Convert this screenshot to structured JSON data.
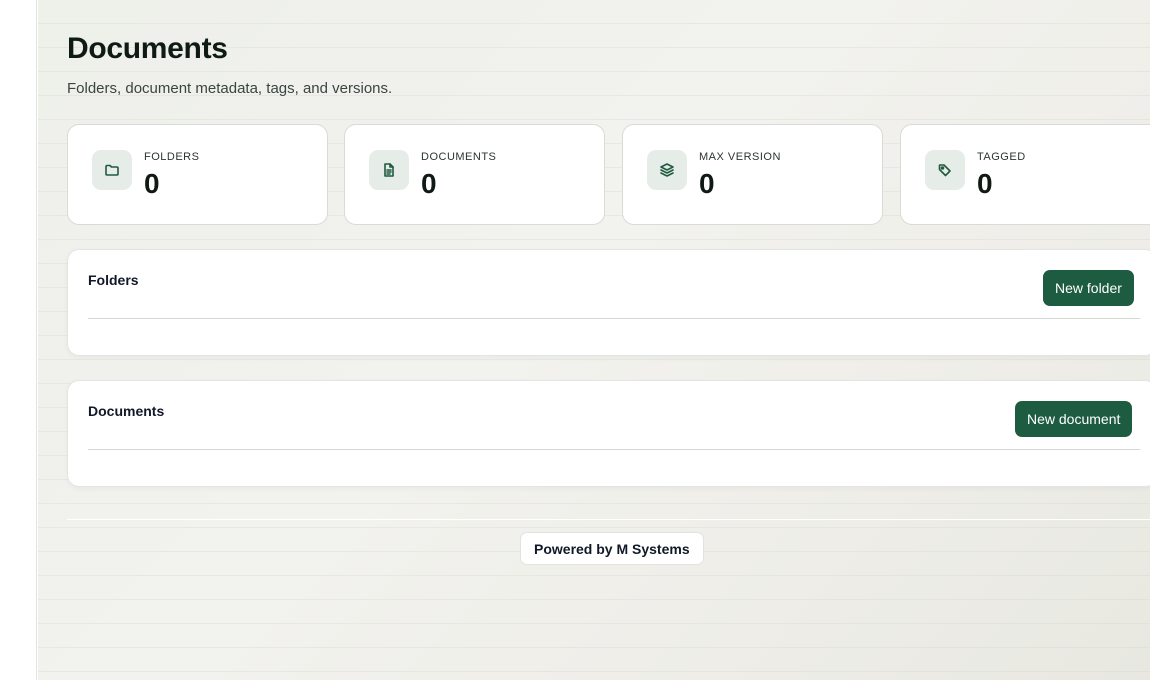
{
  "page": {
    "title": "Documents",
    "subtitle": "Folders, document metadata, tags, and versions."
  },
  "stats": [
    {
      "label": "FOLDERS",
      "value": "0",
      "icon": "folder-icon"
    },
    {
      "label": "DOCUMENTS",
      "value": "0",
      "icon": "document-icon"
    },
    {
      "label": "MAX VERSION",
      "value": "0",
      "icon": "layers-icon"
    },
    {
      "label": "TAGGED",
      "value": "0",
      "icon": "tag-icon"
    }
  ],
  "folders_panel": {
    "title": "Folders",
    "button_label": "New folder"
  },
  "documents_panel": {
    "title": "Documents",
    "button_label": "New document"
  },
  "footer": {
    "badge": "Powered by M Systems"
  },
  "colors": {
    "accent": "#1e5c41",
    "icon_bg": "#e6ece8"
  }
}
